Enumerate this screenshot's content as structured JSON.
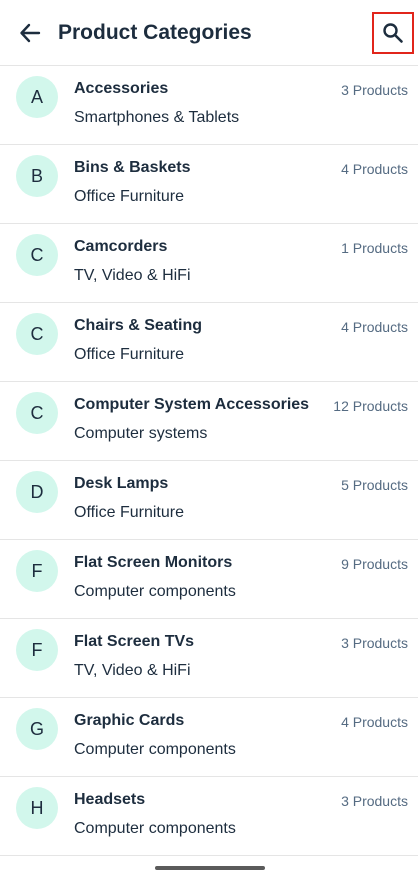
{
  "header": {
    "title": "Product Categories",
    "back_icon": "arrow-left-icon",
    "search_icon": "search-icon",
    "highlight_color": "#e1251b"
  },
  "accent": {
    "avatar_bg": "#d2f7ec",
    "text": "#1d2d3e",
    "secondary_text": "#556b82"
  },
  "categories": [
    {
      "initial": "A",
      "name": "Accessories",
      "group": "Smartphones & Tablets",
      "count": "3 Products"
    },
    {
      "initial": "B",
      "name": "Bins & Baskets",
      "group": "Office Furniture",
      "count": "4 Products"
    },
    {
      "initial": "C",
      "name": "Camcorders",
      "group": "TV, Video & HiFi",
      "count": "1 Products"
    },
    {
      "initial": "C",
      "name": "Chairs & Seating",
      "group": "Office Furniture",
      "count": "4 Products"
    },
    {
      "initial": "C",
      "name": "Computer System Accessories",
      "group": "Computer systems",
      "count": "12 Products"
    },
    {
      "initial": "D",
      "name": "Desk Lamps",
      "group": "Office Furniture",
      "count": "5 Products"
    },
    {
      "initial": "F",
      "name": "Flat Screen Monitors",
      "group": "Computer components",
      "count": "9 Products"
    },
    {
      "initial": "F",
      "name": "Flat Screen TVs",
      "group": "TV, Video & HiFi",
      "count": "3 Products"
    },
    {
      "initial": "G",
      "name": "Graphic Cards",
      "group": "Computer components",
      "count": "4 Products"
    },
    {
      "initial": "H",
      "name": "Headsets",
      "group": "Computer components",
      "count": "3 Products"
    }
  ]
}
